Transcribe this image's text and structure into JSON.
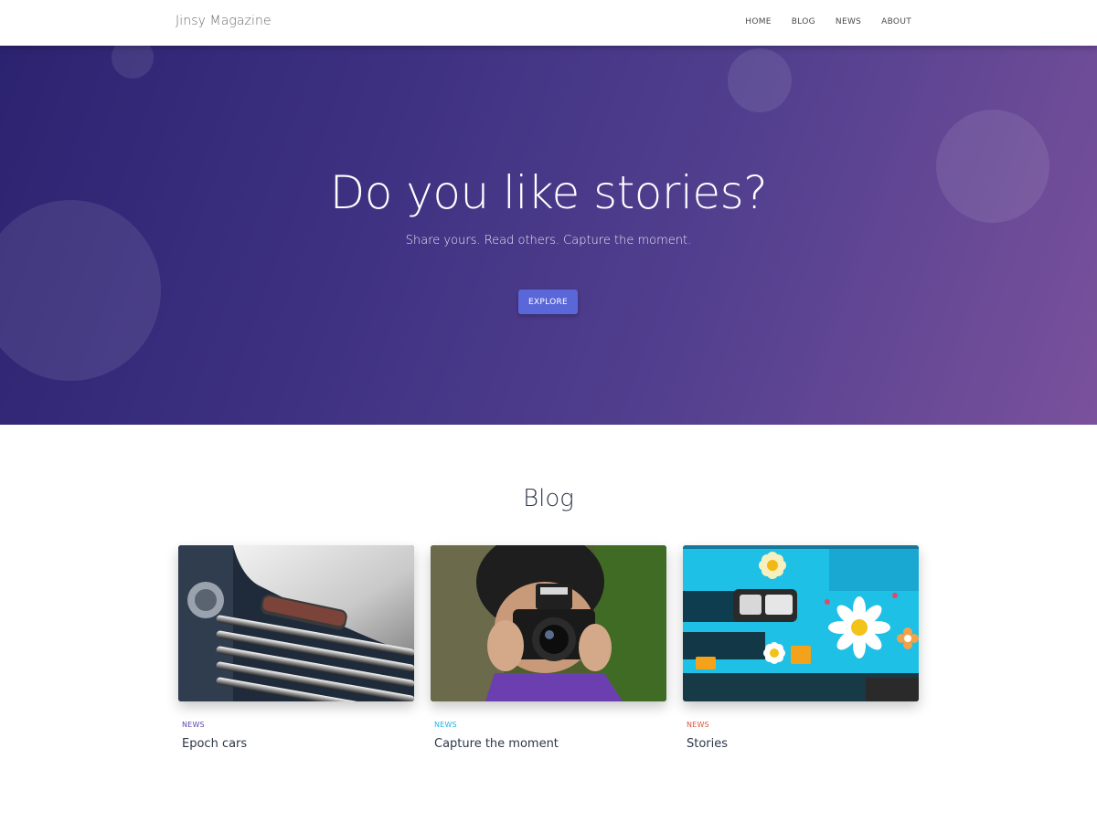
{
  "header": {
    "brand": "Jinsy Magazine",
    "nav": [
      "HOME",
      "BLOG",
      "NEWS",
      "ABOUT"
    ]
  },
  "hero": {
    "title": "Do you like stories?",
    "subtitle": "Share yours. Read others. Capture the moment.",
    "button_label": "EXPLORE"
  },
  "blog": {
    "heading": "Blog",
    "posts": [
      {
        "category": "NEWS",
        "category_color": "#5a4ab0",
        "title": "Epoch cars"
      },
      {
        "category": "NEWS",
        "category_color": "#1eb6e0",
        "title": "Capture the moment"
      },
      {
        "category": "NEWS",
        "category_color": "#e0523a",
        "title": "Stories"
      }
    ]
  },
  "colors": {
    "accent": "#5a67d8",
    "hero_gradient_start": "#2c2370",
    "hero_gradient_end": "#7a519c"
  }
}
